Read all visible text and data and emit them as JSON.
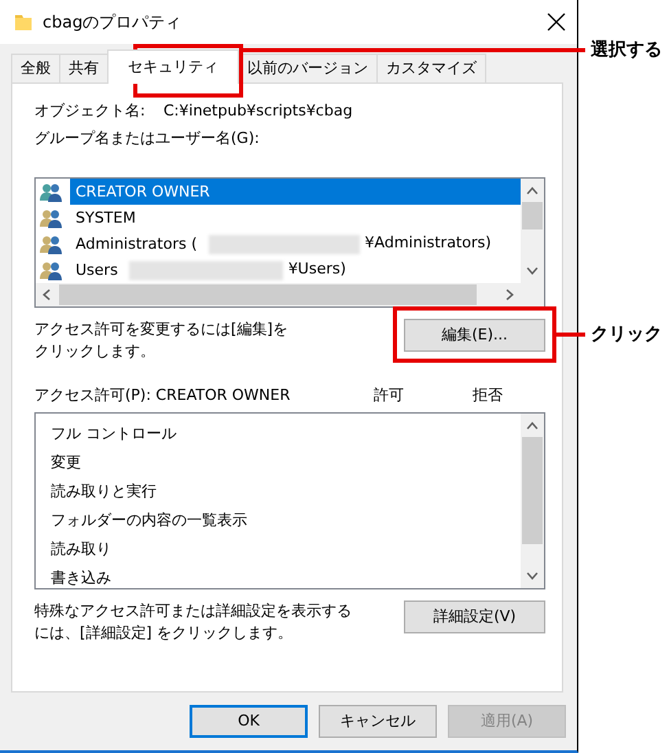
{
  "window": {
    "title": "cbagのプロパティ"
  },
  "tabs": [
    {
      "label": "全般",
      "selected": false
    },
    {
      "label": "共有",
      "selected": false
    },
    {
      "label": "セキュリティ",
      "selected": true
    },
    {
      "label": "以前のバージョン",
      "selected": false
    },
    {
      "label": "カスタマイズ",
      "selected": false
    }
  ],
  "object_name": {
    "label": "オブジェクト名:",
    "value": "C:¥inetpub¥scripts¥cbag"
  },
  "principals_label": "グループ名またはユーザー名(G):",
  "principals": [
    {
      "name": "CREATOR OWNER",
      "redacted": false,
      "selected": true
    },
    {
      "name": "SYSTEM",
      "redacted": false,
      "selected": false
    },
    {
      "name": "Administrators (",
      "redacted": true,
      "suffix": "¥Administrators)",
      "selected": false
    },
    {
      "name": "Users",
      "redacted": true,
      "suffix": "¥Users)",
      "selected": false
    }
  ],
  "edit_hint": [
    "アクセス許可を変更するには[編集]を",
    "クリックします。"
  ],
  "edit_button": "編集(E)...",
  "permissions_label": "アクセス許可(P): CREATOR OWNER",
  "allow_header": "許可",
  "deny_header": "拒否",
  "permissions": [
    "フル コントロール",
    "変更",
    "読み取りと実行",
    "フォルダーの内容の一覧表示",
    "読み取り",
    "書き込み"
  ],
  "advanced_hint": [
    "特殊なアクセス許可または詳細設定を表示する",
    "には、[詳細設定] をクリックします。"
  ],
  "advanced_button": "詳細設定(V)",
  "buttons": [
    {
      "label": "OK",
      "default": true,
      "disabled": false
    },
    {
      "label": "キャンセル",
      "default": false,
      "disabled": false
    },
    {
      "label": "適用(A)",
      "default": false,
      "disabled": true
    }
  ],
  "annotations": [
    {
      "label": "選択する"
    },
    {
      "label": "クリック"
    }
  ]
}
